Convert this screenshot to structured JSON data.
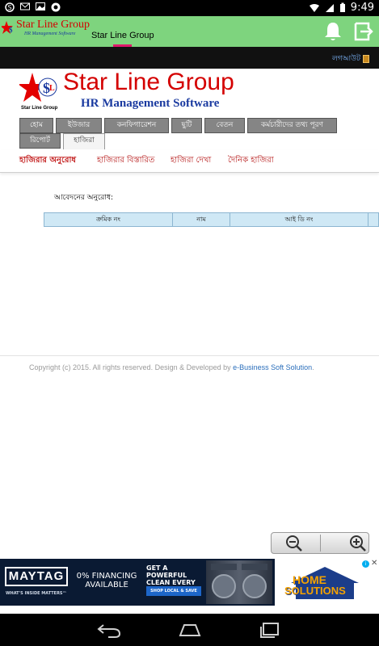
{
  "status_bar": {
    "time": "9:49",
    "icons": [
      "skype-icon",
      "email-icon",
      "image-icon",
      "app-icon"
    ]
  },
  "app_bar": {
    "brand": "Star Line Group",
    "brand_sub": "HR Management Software",
    "title": "Star Line Group"
  },
  "top_strip": {
    "logout_label": "লগআউট"
  },
  "header": {
    "title": "Star Line Group",
    "subtitle": "HR Management Software",
    "logo_label": "Star Line Group"
  },
  "nav": {
    "tabs": [
      {
        "label": "হোম"
      },
      {
        "label": "ইউজার"
      },
      {
        "label": "কনফিগারেশন"
      },
      {
        "label": "ছুটি"
      },
      {
        "label": "বেতন"
      },
      {
        "label": "কর্মচারীদের তথ্য পূরণ"
      },
      {
        "label": "রিপোর্ট"
      },
      {
        "label": "হাজিরা"
      }
    ],
    "active_tab": "হাজিরা"
  },
  "submenu": {
    "items": [
      {
        "label": "হাজিরার অনুরোধ"
      },
      {
        "label": "হাজিরার বিস্তারিত"
      },
      {
        "label": "হাজিরা দেখা"
      },
      {
        "label": "দৈনিক হাজিরা"
      }
    ],
    "active_item": "হাজিরার অনুরোধ"
  },
  "content": {
    "request_label": "আবেদনের অনুরোধ:",
    "table_headers": [
      "ক্রমিক নং",
      "নাম",
      "আই ডি নং"
    ]
  },
  "footer": {
    "text": "Copyright (c) 2015. All rights reserved. Design & Developed by ",
    "link": "e-Business Soft Solution",
    "suffix": "."
  },
  "ad": {
    "maytag": {
      "logo": "MAYTAG",
      "tagline": "WHAT'S INSIDE MATTERS™",
      "financing_line1": "0% FINANCING",
      "financing_line2": "AVAILABLE",
      "headline": "GET A POWERFUL CLEAN EVERY TIME",
      "cta": "SHOP LOCAL & SAVE"
    },
    "home_solutions": {
      "line1": "HOME",
      "line2": "SOLUTIONS"
    },
    "close": "✕"
  },
  "colors": {
    "app_bar": "#7ed47e",
    "brand_red": "#d40000",
    "brand_blue": "#1a3aa0",
    "nav_tab": "#858585",
    "submenu_text": "#b51515",
    "table_header": "#cfe8f5"
  }
}
